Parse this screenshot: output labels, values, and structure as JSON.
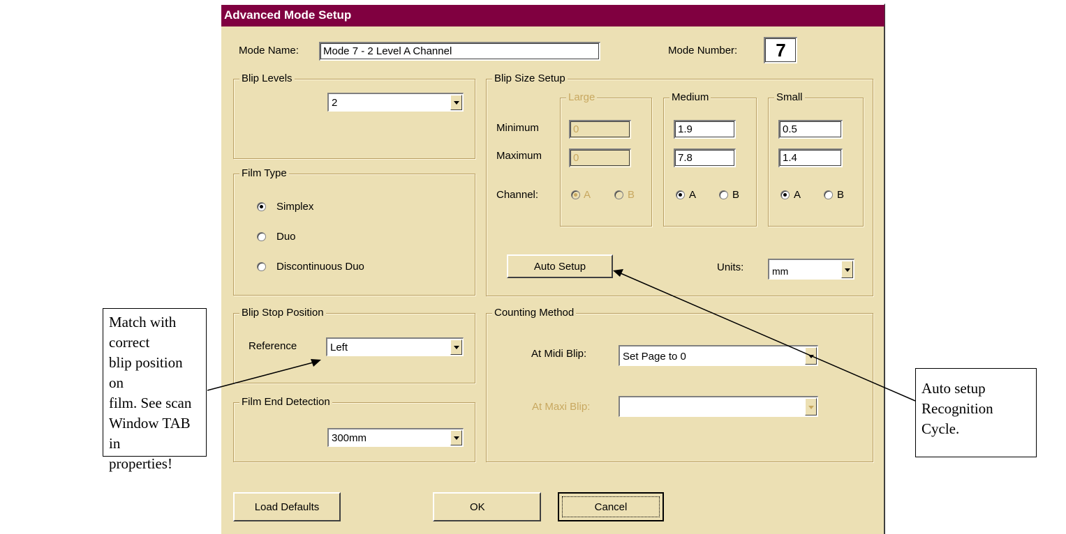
{
  "dialog": {
    "title": "Advanced Mode Setup",
    "mode_name_label": "Mode Name:",
    "mode_name_value": "Mode 7 - 2 Level A Channel",
    "mode_number_label": "Mode Number:",
    "mode_number_value": "7"
  },
  "blip_levels": {
    "title": "Blip Levels",
    "value": "2"
  },
  "film_type": {
    "title": "Film Type",
    "options": [
      "Simplex",
      "Duo",
      "Discontinuous Duo"
    ],
    "selected": "Simplex"
  },
  "blip_stop": {
    "title": "Blip Stop Position",
    "reference_label": "Reference",
    "value": "Left"
  },
  "film_end": {
    "title": "Film End Detection",
    "value": "300mm"
  },
  "blip_size": {
    "title": "Blip Size Setup",
    "row_labels": {
      "minimum": "Minimum",
      "maximum": "Maximum",
      "channel": "Channel:"
    },
    "large": {
      "title": "Large",
      "minimum": "0",
      "maximum": "0",
      "channel_a": "A",
      "channel_b": "B"
    },
    "medium": {
      "title": "Medium",
      "minimum": "1.9",
      "maximum": "7.8",
      "channel_a": "A",
      "channel_b": "B"
    },
    "small": {
      "title": "Small",
      "minimum": "0.5",
      "maximum": "1.4",
      "channel_a": "A",
      "channel_b": "B"
    },
    "auto_setup_label": "Auto Setup",
    "units_label": "Units:",
    "units_value": "mm"
  },
  "counting": {
    "title": "Counting Method",
    "midi_label": "At Midi Blip:",
    "midi_value": "Set Page to 0",
    "maxi_label": "At Maxi Blip:",
    "maxi_value": ""
  },
  "buttons": {
    "load_defaults": "Load Defaults",
    "ok": "OK",
    "cancel": "Cancel"
  },
  "callouts": {
    "left": [
      "Match with correct",
      "blip position on",
      "film. See scan",
      "Window TAB in",
      "properties!"
    ],
    "right": [
      "Auto setup",
      "Recognition",
      "Cycle."
    ]
  },
  "colors": {
    "title_bar": "#800040",
    "dialog_bg": "#ece0b4",
    "disabled_text": "#c8a860"
  }
}
